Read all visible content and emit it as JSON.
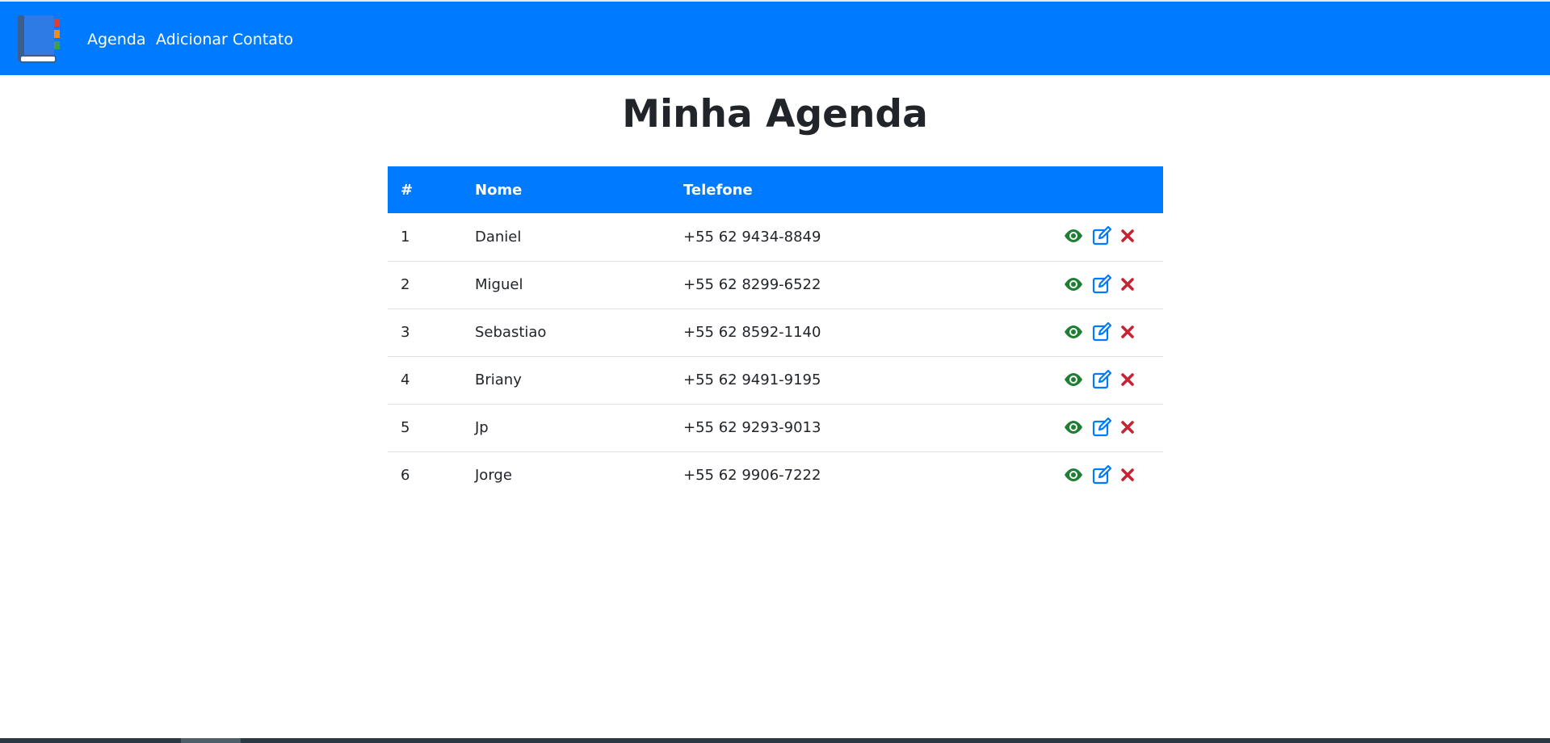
{
  "navbar": {
    "links": [
      {
        "label": "Agenda"
      },
      {
        "label": "Adicionar Contato"
      }
    ],
    "color": "#007bff"
  },
  "page": {
    "title": "Minha Agenda"
  },
  "table": {
    "headers": [
      "#",
      "Nome",
      "Telefone",
      ""
    ],
    "rows": [
      {
        "num": "1",
        "name": "Daniel",
        "phone": "+55 62 9434-8849"
      },
      {
        "num": "2",
        "name": "Miguel",
        "phone": "+55 62 8299-6522"
      },
      {
        "num": "3",
        "name": "Sebastiao",
        "phone": "+55 62 8592-1140"
      },
      {
        "num": "4",
        "name": "Briany",
        "phone": "+55 62 9491-9195"
      },
      {
        "num": "5",
        "name": "Jp",
        "phone": "+55 62 9293-9013"
      },
      {
        "num": "6",
        "name": "Jorge",
        "phone": "+55 62 9906-7222"
      }
    ],
    "row_actions": [
      {
        "icon": "eye-icon",
        "color": "#1e7e34"
      },
      {
        "icon": "edit-icon",
        "color": "#007bff"
      },
      {
        "icon": "close-icon",
        "color": "#c82333"
      }
    ]
  }
}
